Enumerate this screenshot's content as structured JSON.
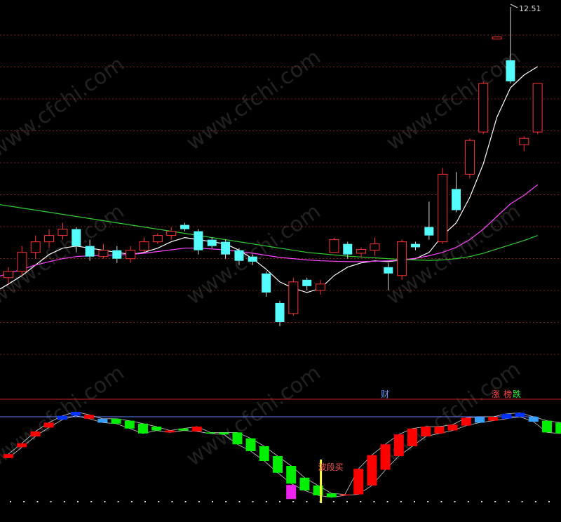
{
  "chart_data": [
    {
      "type": "candlestick",
      "panel": "price",
      "max_price_label": "12.51",
      "y_scale_note": "relative price units (axis not labeled)",
      "candles": [
        {
          "o": 6.1,
          "h": 6.35,
          "l": 5.95,
          "c": 6.25
        },
        {
          "o": 6.25,
          "h": 6.85,
          "l": 6.15,
          "c": 6.7
        },
        {
          "o": 6.7,
          "h": 7.1,
          "l": 6.55,
          "c": 6.95
        },
        {
          "o": 6.95,
          "h": 7.25,
          "l": 6.8,
          "c": 7.1
        },
        {
          "o": 7.1,
          "h": 7.4,
          "l": 7.0,
          "c": 7.25
        },
        {
          "o": 7.25,
          "h": 7.3,
          "l": 6.7,
          "c": 6.85
        },
        {
          "o": 6.85,
          "h": 7.0,
          "l": 6.5,
          "c": 6.6
        },
        {
          "o": 6.6,
          "h": 6.9,
          "l": 6.55,
          "c": 6.75
        },
        {
          "o": 6.75,
          "h": 6.85,
          "l": 6.45,
          "c": 6.55
        },
        {
          "o": 6.55,
          "h": 6.85,
          "l": 6.45,
          "c": 6.75
        },
        {
          "o": 6.75,
          "h": 7.05,
          "l": 6.7,
          "c": 6.95
        },
        {
          "o": 6.95,
          "h": 7.15,
          "l": 6.9,
          "c": 7.1
        },
        {
          "o": 7.1,
          "h": 7.3,
          "l": 7.0,
          "c": 7.2
        },
        {
          "o": 7.35,
          "h": 7.4,
          "l": 7.2,
          "c": 7.25
        },
        {
          "o": 7.2,
          "h": 7.25,
          "l": 6.65,
          "c": 6.75
        },
        {
          "o": 7.0,
          "h": 7.05,
          "l": 6.8,
          "c": 6.85
        },
        {
          "o": 6.95,
          "h": 7.0,
          "l": 6.55,
          "c": 6.65
        },
        {
          "o": 6.75,
          "h": 6.8,
          "l": 6.4,
          "c": 6.5
        },
        {
          "o": 6.6,
          "h": 6.65,
          "l": 6.4,
          "c": 6.48
        },
        {
          "o": 6.2,
          "h": 6.25,
          "l": 5.65,
          "c": 5.75
        },
        {
          "o": 5.5,
          "h": 5.55,
          "l": 4.95,
          "c": 5.05
        },
        {
          "o": 5.25,
          "h": 6.1,
          "l": 5.2,
          "c": 6.0
        },
        {
          "o": 6.05,
          "h": 6.1,
          "l": 5.8,
          "c": 5.9
        },
        {
          "o": 5.8,
          "h": 6.05,
          "l": 5.7,
          "c": 5.95
        },
        {
          "o": 6.7,
          "h": 7.05,
          "l": 6.7,
          "c": 7.0
        },
        {
          "o": 6.9,
          "h": 6.95,
          "l": 6.55,
          "c": 6.65
        },
        {
          "o": 6.68,
          "h": 6.82,
          "l": 6.58,
          "c": 6.77
        },
        {
          "o": 6.75,
          "h": 7.05,
          "l": 6.62,
          "c": 6.9
        },
        {
          "o": 6.35,
          "h": 6.45,
          "l": 5.8,
          "c": 6.2
        },
        {
          "o": 6.15,
          "h": 7.0,
          "l": 6.05,
          "c": 6.95
        },
        {
          "o": 6.9,
          "h": 6.95,
          "l": 6.75,
          "c": 6.82
        },
        {
          "o": 7.3,
          "h": 7.9,
          "l": 7.0,
          "c": 7.1
        },
        {
          "o": 6.95,
          "h": 8.7,
          "l": 6.9,
          "c": 8.55
        },
        {
          "o": 8.2,
          "h": 8.6,
          "l": 7.65,
          "c": 7.7
        },
        {
          "o": 8.55,
          "h": 9.4,
          "l": 8.45,
          "c": 9.35
        },
        {
          "o": 9.55,
          "h": 10.75,
          "l": 9.5,
          "c": 10.7
        },
        {
          "o": 11.75,
          "h": 11.8,
          "l": 11.75,
          "c": 11.8
        },
        {
          "o": 11.25,
          "h": 12.51,
          "l": 10.7,
          "c": 10.75
        },
        {
          "o": 9.25,
          "h": 9.45,
          "l": 9.1,
          "c": 9.4
        },
        {
          "o": 9.55,
          "h": 10.7,
          "l": 9.5,
          "c": 10.7
        }
      ],
      "series": [
        {
          "color": "#ffffff",
          "values": [
            5.95,
            6.15,
            6.4,
            6.65,
            6.8,
            6.85,
            6.8,
            6.75,
            6.7,
            6.65,
            6.7,
            6.8,
            6.95,
            7.05,
            7.0,
            6.95,
            6.9,
            6.75,
            6.55,
            6.3,
            6.0,
            5.85,
            5.75,
            5.85,
            6.15,
            6.35,
            6.45,
            6.5,
            6.48,
            6.52,
            6.55,
            6.7,
            7.1,
            7.4,
            8.0,
            8.8,
            9.9,
            10.6,
            10.9,
            11.1
          ]
        },
        {
          "color": "#ff44ff",
          "values": [
            6.2,
            6.3,
            6.4,
            6.48,
            6.55,
            6.6,
            6.62,
            6.63,
            6.64,
            6.65,
            6.68,
            6.72,
            6.76,
            6.8,
            6.8,
            6.78,
            6.76,
            6.72,
            6.68,
            6.63,
            6.58,
            6.55,
            6.52,
            6.5,
            6.49,
            6.48,
            6.48,
            6.49,
            6.5,
            6.52,
            6.56,
            6.62,
            6.7,
            6.82,
            7.0,
            7.25,
            7.55,
            7.85,
            8.05,
            8.3
          ]
        },
        {
          "color": "#33cc33",
          "values": [
            7.8,
            7.75,
            7.7,
            7.65,
            7.6,
            7.55,
            7.5,
            7.45,
            7.4,
            7.35,
            7.3,
            7.25,
            7.2,
            7.15,
            7.1,
            7.05,
            7.0,
            6.95,
            6.9,
            6.85,
            6.8,
            6.75,
            6.7,
            6.67,
            6.64,
            6.61,
            6.59,
            6.57,
            6.55,
            6.53,
            6.52,
            6.51,
            6.52,
            6.55,
            6.6,
            6.68,
            6.78,
            6.88,
            6.98,
            7.1
          ]
        }
      ]
    },
    {
      "type": "bar",
      "panel": "indicator",
      "y_scale_note": "relative indicator units (axis not labeled)",
      "bars": [
        {
          "top": 52,
          "bot": 48,
          "color": "red"
        },
        {
          "top": 63,
          "bot": 59,
          "color": "red"
        },
        {
          "top": 75,
          "bot": 70,
          "color": "red"
        },
        {
          "top": 84,
          "bot": 79,
          "color": "red"
        },
        {
          "top": 91,
          "bot": 87,
          "color": "blue"
        },
        {
          "top": 95,
          "bot": 91,
          "color": "blue"
        },
        {
          "top": 92,
          "bot": 88,
          "color": "red"
        },
        {
          "top": 88,
          "bot": 84,
          "color": "cyan"
        },
        {
          "top": 88,
          "bot": 83,
          "color": "green"
        },
        {
          "top": 86,
          "bot": 78,
          "color": "green"
        },
        {
          "top": 83,
          "bot": 73,
          "color": "green"
        },
        {
          "top": 80,
          "bot": 76,
          "color": "green"
        },
        {
          "top": 76,
          "bot": 74,
          "color": "red"
        },
        {
          "top": 78,
          "bot": 76,
          "color": "green"
        },
        {
          "top": 80,
          "bot": 75,
          "color": "red"
        },
        {
          "top": 74,
          "bot": 73,
          "color": "green"
        },
        {
          "top": 74,
          "bot": 72,
          "color": "green"
        },
        {
          "top": 74,
          "bot": 62,
          "color": "green"
        },
        {
          "top": 68,
          "bot": 55,
          "color": "green"
        },
        {
          "top": 60,
          "bot": 45,
          "color": "green"
        },
        {
          "top": 50,
          "bot": 33,
          "color": "green"
        },
        {
          "top": 40,
          "bot": 22,
          "color": "green"
        },
        {
          "top": 28,
          "bot": 15,
          "color": "green"
        },
        {
          "top": 20,
          "bot": 10,
          "color": "green"
        },
        {
          "top": 12,
          "bot": 8,
          "color": "green"
        },
        {
          "top": 11,
          "bot": 10,
          "color": "red"
        },
        {
          "top": 37,
          "bot": 11,
          "color": "red"
        },
        {
          "top": 51,
          "bot": 20,
          "color": "red"
        },
        {
          "top": 62,
          "bot": 36,
          "color": "red"
        },
        {
          "top": 72,
          "bot": 50,
          "color": "red"
        },
        {
          "top": 78,
          "bot": 60,
          "color": "red"
        },
        {
          "top": 80,
          "bot": 70,
          "color": "red"
        },
        {
          "top": 80,
          "bot": 73,
          "color": "red"
        },
        {
          "top": 82,
          "bot": 76,
          "color": "red"
        },
        {
          "top": 89,
          "bot": 81,
          "color": "red"
        },
        {
          "top": 90,
          "bot": 84,
          "color": "cyan"
        },
        {
          "top": 90,
          "bot": 86,
          "color": "red"
        },
        {
          "top": 93,
          "bot": 88,
          "color": "blue"
        },
        {
          "top": 94,
          "bot": 90,
          "color": "blue"
        },
        {
          "top": 90,
          "bot": 85,
          "color": "cyan"
        },
        {
          "top": 86,
          "bot": 74,
          "color": "green"
        },
        {
          "top": 84,
          "bot": 73,
          "color": "green"
        }
      ],
      "dip_marker_index": 21,
      "signal_index": 23,
      "signal_label": "波段买",
      "top_label_cai": "财",
      "top_label_zhang": "涨",
      "top_label_rank": "榜",
      "top_label_die": "跌",
      "reference_line_level": 90
    }
  ],
  "watermark_text": "www.cfchi.com",
  "colors": {
    "up": "#ff3333",
    "down": "#54fcfc",
    "ind_red": "#ff0000",
    "ind_green": "#00ee00",
    "ind_blue": "#0033ff",
    "ind_cyan": "#3aa0ff",
    "magenta": "#ee22ee",
    "signal": "#ffff33",
    "separator": "#cc2222",
    "ref_line": "#5f7fff",
    "grid": "#7a1f1f",
    "text": "#dddddd",
    "blue_text": "#6a9cff"
  }
}
